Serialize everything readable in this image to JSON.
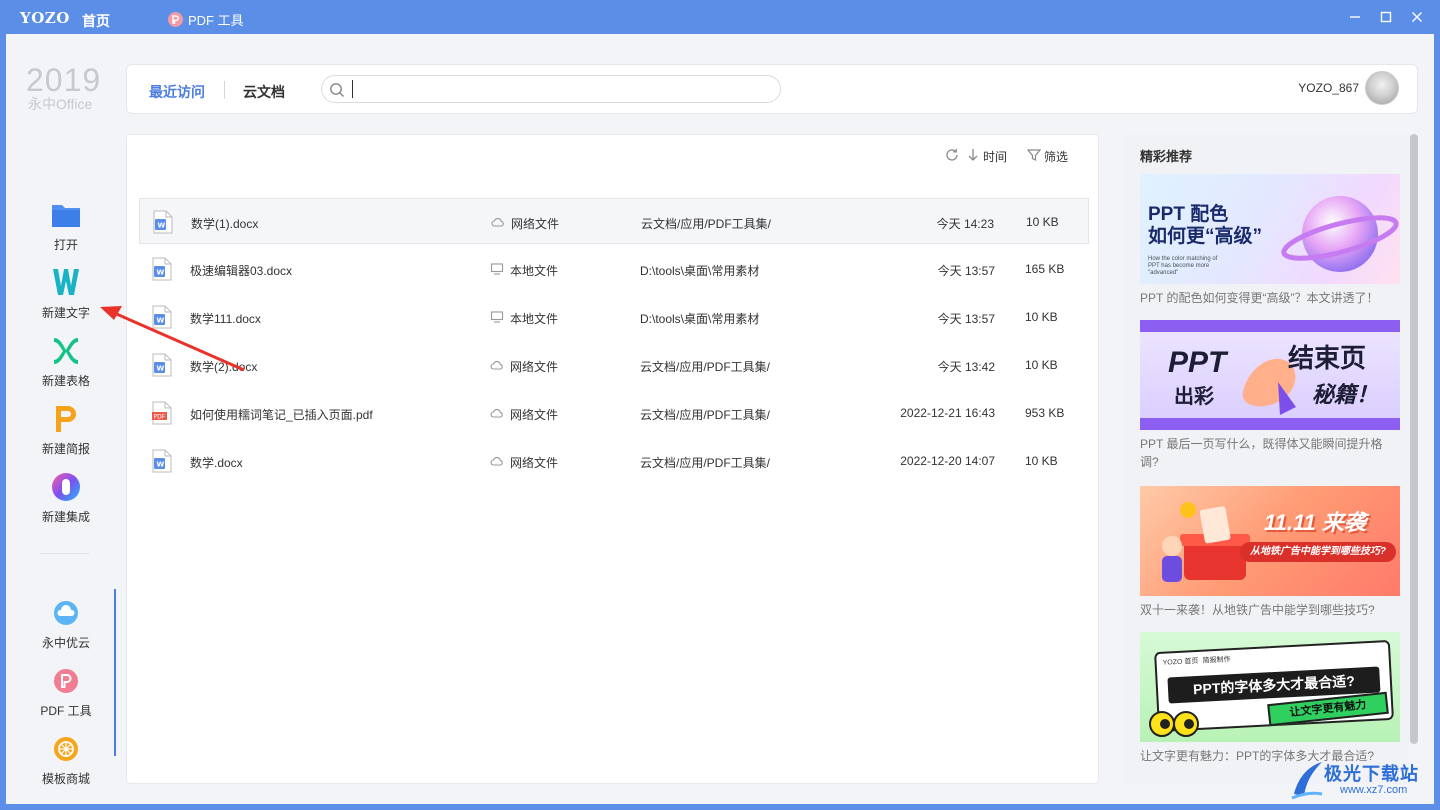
{
  "titlebar": {
    "logo": "YOZO",
    "home_tab": "首页",
    "pdf_tab": "PDF 工具"
  },
  "brand": {
    "year": "2019",
    "name": "永中Office"
  },
  "sidebar": {
    "items": [
      {
        "label": "打开",
        "icon": "folder-icon"
      },
      {
        "label": "新建文字",
        "icon": "word-w-icon"
      },
      {
        "label": "新建表格",
        "icon": "spreadsheet-x-icon"
      },
      {
        "label": "新建简报",
        "icon": "presentation-p-icon"
      },
      {
        "label": "新建集成",
        "icon": "integration-icon"
      }
    ],
    "bottom": [
      {
        "label": "永中优云",
        "icon": "cloud-icon"
      },
      {
        "label": "PDF 工具",
        "icon": "pdf-tool-icon"
      },
      {
        "label": "模板商城",
        "icon": "template-store-icon"
      }
    ]
  },
  "header": {
    "tab_recent": "最近访问",
    "tab_cloud": "云文档",
    "search_placeholder": "",
    "username": "YOZO_867"
  },
  "toolbar": {
    "sort_label": "时间",
    "filter_label": "筛选"
  },
  "files": [
    {
      "name": "数学(1).docx",
      "type": "docx",
      "location": "网络文件",
      "loc_icon": "cloud-icon",
      "path": "云文档/应用/PDF工具集/",
      "time": "今天 14:23",
      "size": "10 KB"
    },
    {
      "name": "极速编辑器03.docx",
      "type": "docx",
      "location": "本地文件",
      "loc_icon": "monitor-icon",
      "path": "D:\\tools\\桌面\\常用素材",
      "time": "今天 13:57",
      "size": "165 KB"
    },
    {
      "name": "数学111.docx",
      "type": "docx",
      "location": "本地文件",
      "loc_icon": "monitor-icon",
      "path": "D:\\tools\\桌面\\常用素材",
      "time": "今天 13:57",
      "size": "10 KB"
    },
    {
      "name": "数学(2).docx",
      "type": "docx",
      "location": "网络文件",
      "loc_icon": "cloud-icon",
      "path": "云文档/应用/PDF工具集/",
      "time": "今天 13:42",
      "size": "10 KB"
    },
    {
      "name": "如何使用糯词笔记_已插入页面.pdf",
      "type": "pdf",
      "location": "网络文件",
      "loc_icon": "cloud-icon",
      "path": "云文档/应用/PDF工具集/",
      "time": "2022-12-21 16:43",
      "size": "953 KB"
    },
    {
      "name": "数学.docx",
      "type": "docx",
      "location": "网络文件",
      "loc_icon": "cloud-icon",
      "path": "云文档/应用/PDF工具集/",
      "time": "2022-12-20 14:07",
      "size": "10 KB"
    }
  ],
  "recommend": {
    "title": "精彩推荐",
    "cards": [
      {
        "caption": "PPT 的配色如何变得更“高级”？本文讲透了！",
        "img_text1": "PPT 配色",
        "img_text2": "如何更“高级”",
        "img_small": "How the color matching of PPT has become more \"advanced\""
      },
      {
        "caption": "PPT 最后一页写什么，既得体又能瞬间提升格调?",
        "img_text1": "PPT",
        "img_text2": "出彩",
        "img_text3": "结束页",
        "img_text4": "秘籍！"
      },
      {
        "caption": "双十一来袭！从地铁广告中能学到哪些技巧?",
        "img_text1": "11.11 来袭",
        "img_text2": "从地铁广告中能学到哪些技巧?"
      },
      {
        "caption": "让文字更有魅力：PPT的字体多大才最合适?",
        "img_text1": "PPT的字体多大才最合适?",
        "img_text2": "让文字更有魅力",
        "img_small1": "YOZO 首页",
        "img_small2": "简报制作"
      }
    ]
  },
  "watermark": {
    "text": "极光下载站",
    "url": "www.xz7.com"
  },
  "colors": {
    "accent": "#4c7de0",
    "titlebar": "#5b8ee6",
    "annotation_arrow": "#e8322a"
  }
}
